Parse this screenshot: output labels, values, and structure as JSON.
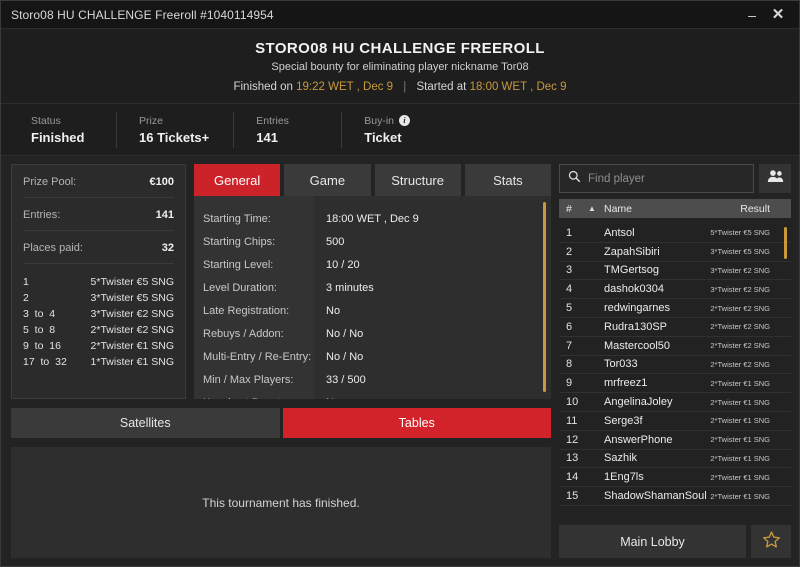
{
  "window": {
    "titlebar_text": "Storo08 HU CHALLENGE Freeroll #1040114954",
    "minimize_label": "–",
    "close_label": "✕"
  },
  "header": {
    "title": "STORO08 HU CHALLENGE FREEROLL",
    "subtitle": "Special bounty for eliminating player nickname Tor08",
    "finished_prefix": "Finished on",
    "finished_time": "19:22 WET , Dec 9",
    "divider": "|",
    "started_prefix": "Started at",
    "started_time": "18:00 WET , Dec 9"
  },
  "status": {
    "items": [
      {
        "label": "Status",
        "value": "Finished",
        "info": false
      },
      {
        "label": "Prize",
        "value": "16 Tickets+",
        "info": false
      },
      {
        "label": "Entries",
        "value": "141",
        "info": false
      },
      {
        "label": "Buy-in",
        "value": "Ticket",
        "info": true
      }
    ],
    "info_icon_glyph": "i"
  },
  "prize_panel": {
    "rows": [
      {
        "key": "Prize Pool:",
        "value": "€100"
      },
      {
        "key": "Entries:",
        "value": "141"
      },
      {
        "key": "Places paid:",
        "value": "32"
      }
    ],
    "payouts": [
      {
        "place": "1",
        "prize": "5*Twister €5 SNG"
      },
      {
        "place": "2",
        "prize": "3*Twister €5 SNG"
      },
      {
        "place": "3  to  4",
        "prize": "3*Twister €2 SNG"
      },
      {
        "place": "5  to  8",
        "prize": "2*Twister €2 SNG"
      },
      {
        "place": "9  to  16",
        "prize": "2*Twister €1 SNG"
      },
      {
        "place": "17  to  32",
        "prize": "1*Twister €1 SNG"
      }
    ]
  },
  "tabs": {
    "items": [
      {
        "label": "General",
        "active": true
      },
      {
        "label": "Game",
        "active": false
      },
      {
        "label": "Structure",
        "active": false
      },
      {
        "label": "Stats",
        "active": false
      }
    ]
  },
  "general": {
    "rows": [
      {
        "label": "Starting Time:",
        "value": "18:00 WET , Dec 9"
      },
      {
        "label": "Starting Chips:",
        "value": "500"
      },
      {
        "label": "Starting Level:",
        "value": "10 / 20"
      },
      {
        "label": "Level Duration:",
        "value": "3 minutes"
      },
      {
        "label": "Late Registration:",
        "value": "No"
      },
      {
        "label": "Rebuys / Addon:",
        "value": "No / No"
      },
      {
        "label": "Multi-Entry / Re-Entry:",
        "value": "No / No"
      },
      {
        "label": "Min / Max Players:",
        "value": "33 / 500"
      },
      {
        "label": "Knockout Bounty:",
        "value": "No"
      }
    ]
  },
  "bottom_tabs": {
    "items": [
      {
        "label": "Satellites",
        "active": false
      },
      {
        "label": "Tables",
        "active": true
      }
    ],
    "message": "This tournament has finished."
  },
  "players_panel": {
    "search_placeholder": "Find player",
    "search_value": "",
    "columns": {
      "num": "#",
      "sort": "▲",
      "name": "Name",
      "result": "Result"
    },
    "rows": [
      {
        "num": "1",
        "name": "Antsol",
        "result": "5*Twister €5 SNG"
      },
      {
        "num": "2",
        "name": "ZapahSibiri",
        "result": "3*Twister €5 SNG"
      },
      {
        "num": "3",
        "name": "TMGertsog",
        "result": "3*Twister €2 SNG"
      },
      {
        "num": "4",
        "name": "dashok0304",
        "result": "3*Twister €2 SNG"
      },
      {
        "num": "5",
        "name": "redwingarnes",
        "result": "2*Twister €2 SNG"
      },
      {
        "num": "6",
        "name": "Rudra130SP",
        "result": "2*Twister €2 SNG"
      },
      {
        "num": "7",
        "name": "Mastercool50",
        "result": "2*Twister €2 SNG"
      },
      {
        "num": "8",
        "name": "Tor033",
        "result": "2*Twister €2 SNG"
      },
      {
        "num": "9",
        "name": "mrfreez1",
        "result": "2*Twister €1 SNG"
      },
      {
        "num": "10",
        "name": "AngelinaJoley",
        "result": "2*Twister €1 SNG"
      },
      {
        "num": "11",
        "name": "Serge3f",
        "result": "2*Twister €1 SNG"
      },
      {
        "num": "12",
        "name": "AnswerPhone",
        "result": "2*Twister €1 SNG"
      },
      {
        "num": "13",
        "name": "Sazhik",
        "result": "2*Twister €1 SNG"
      },
      {
        "num": "14",
        "name": "1Eng7ls",
        "result": "2*Twister €1 SNG"
      },
      {
        "num": "15",
        "name": "ShadowShamanSoul",
        "result": "2*Twister €1 SNG"
      }
    ],
    "main_lobby_label": "Main Lobby"
  },
  "colors": {
    "accent_red": "#cc2229",
    "accent_gold": "#c89a3c",
    "window_bg": "#232323",
    "panel_bg": "#2e2e2e"
  }
}
